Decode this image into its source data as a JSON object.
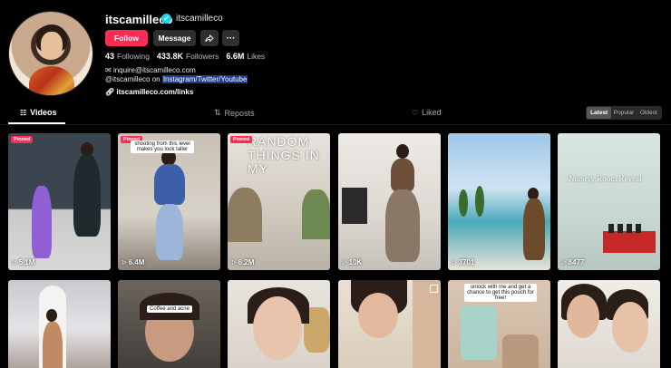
{
  "profile": {
    "username": "itscamilleco",
    "nickname": "itscamilleco",
    "follow_label": "Follow",
    "message_label": "Message",
    "more_label": "···",
    "stats": {
      "following_count": "43",
      "following_label": "Following",
      "followers_count": "433.8K",
      "followers_label": "Followers",
      "likes_count": "6.6M",
      "likes_label": "Likes"
    },
    "bio_line1": "inquire@itscamilleco.com",
    "bio_line2_prefix": "@itscamilleco on ",
    "bio_line2_highlight": "Instagram/Twitter/Youtube",
    "link": "itscamilleco.com/links"
  },
  "tabs": {
    "videos": "Videos",
    "reposts": "Reposts",
    "liked": "Liked"
  },
  "sort": {
    "latest": "Latest",
    "popular": "Popular",
    "oldest": "Oldest",
    "selected": "Latest"
  },
  "videos": [
    {
      "pinned_label": "Pinned",
      "views": "5.1M"
    },
    {
      "pinned_label": "Pinned",
      "views": "6.4M",
      "caption": "shooting from this level makes you look taller"
    },
    {
      "pinned_label": "Pinned",
      "views": "6.2M",
      "overlay_text": "RANDOM THINGS IN MY"
    },
    {
      "views": "10K"
    },
    {
      "views": "3701"
    },
    {
      "views": "8477",
      "overlay_text": "Nursery Room Reveal"
    },
    {},
    {
      "caption": "Coffee and acne"
    },
    {},
    {},
    {
      "caption": "unlock with me and get a chance to get this pouch for free!"
    },
    {}
  ]
}
